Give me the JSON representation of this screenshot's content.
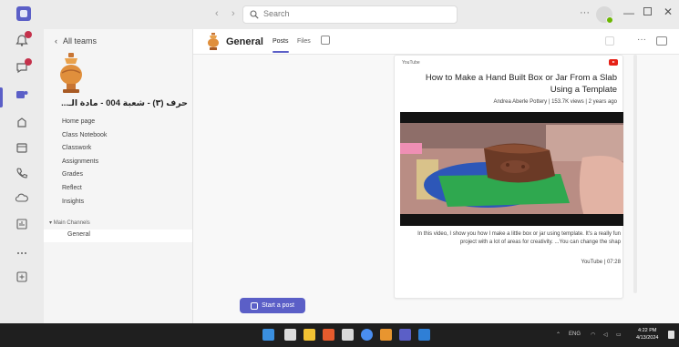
{
  "titlebar": {
    "search_placeholder": "Search",
    "more": "···",
    "minimize": "—",
    "close": "✕"
  },
  "rail": {
    "items": [
      {
        "label": "",
        "icon": "bell-icon",
        "badge": true
      },
      {
        "label": "",
        "icon": "chat-icon",
        "badge": true
      },
      {
        "label": "",
        "icon": "teams-icon",
        "active": true
      },
      {
        "label": "",
        "icon": "assignments-icon"
      },
      {
        "label": "",
        "icon": "calendar-icon"
      },
      {
        "label": "",
        "icon": "calls-icon"
      },
      {
        "label": "",
        "icon": "onedrive-icon"
      },
      {
        "label": "",
        "icon": "insights-icon"
      },
      {
        "label": "",
        "icon": "more-apps-icon"
      },
      {
        "label": "",
        "icon": "apps-icon"
      }
    ]
  },
  "sidebar": {
    "back_label": "All teams",
    "team_name": "حرف (٣) - شعبة 004 - مادة الـ...",
    "team_more": "···",
    "nav": [
      "Home page",
      "Class Notebook",
      "Classwork",
      "Assignments",
      "Grades",
      "Reflect",
      "Insights"
    ],
    "channels_header": "Main Channels",
    "channel": "General"
  },
  "channel": {
    "title": "General",
    "tabs": [
      "Posts",
      "Files"
    ]
  },
  "card": {
    "source": "YouTube",
    "title": "How to Make a Hand Built Box or Jar From a Slab Using a Template",
    "meta": "Andrea Aberle Pottery | 153.7K views | 2 years ago",
    "description": "In this video, I show you how I make a little box or jar using template. It's a really fun project with a lot of areas for creativity. ...You can change the shap",
    "footer": "YouTube | 07:28"
  },
  "start_post": "Start a post",
  "taskbar": {
    "lang": "ENG",
    "time": "4:22 PM",
    "date": "4/13/2024"
  },
  "colors": {
    "brand": "#5b5fc7",
    "badge": "#c4314b",
    "youtube": "#e62117"
  }
}
